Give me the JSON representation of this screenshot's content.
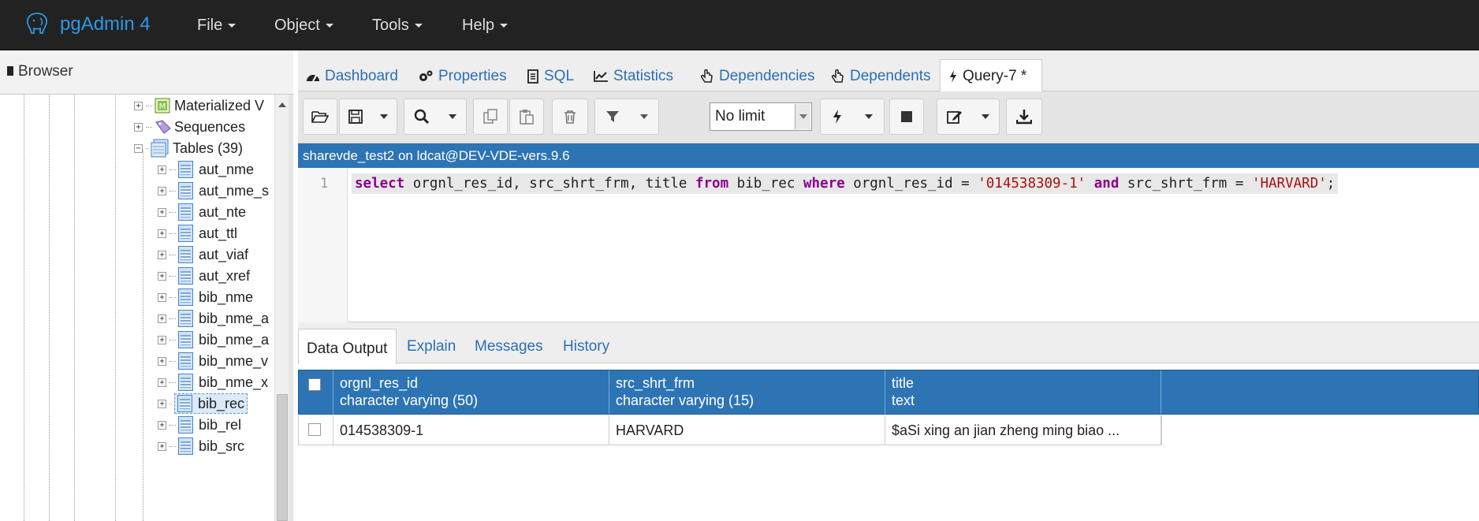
{
  "app": {
    "title": "pgAdmin 4",
    "brand_color": "#2d98e3"
  },
  "menu": [
    "File",
    "Object",
    "Tools",
    "Help"
  ],
  "browser": {
    "title": "Browser",
    "items": [
      {
        "label": "Materialized V",
        "icon": "materialized-view-icon",
        "expanded": false
      },
      {
        "label": "Sequences",
        "icon": "sequence-icon",
        "expanded": false
      },
      {
        "label": "Tables (39)",
        "icon": "tables-icon",
        "expanded": true
      },
      {
        "label": "aut_nme",
        "icon": "table-icon"
      },
      {
        "label": "aut_nme_s",
        "icon": "table-icon"
      },
      {
        "label": "aut_nte",
        "icon": "table-icon"
      },
      {
        "label": "aut_ttl",
        "icon": "table-icon"
      },
      {
        "label": "aut_viaf",
        "icon": "table-icon"
      },
      {
        "label": "aut_xref",
        "icon": "table-icon"
      },
      {
        "label": "bib_nme",
        "icon": "table-icon"
      },
      {
        "label": "bib_nme_a",
        "icon": "table-icon"
      },
      {
        "label": "bib_nme_a",
        "icon": "table-icon"
      },
      {
        "label": "bib_nme_v",
        "icon": "table-icon"
      },
      {
        "label": "bib_nme_x",
        "icon": "table-icon"
      },
      {
        "label": "bib_rec",
        "icon": "table-icon",
        "selected": true
      },
      {
        "label": "bib_rel",
        "icon": "table-icon"
      },
      {
        "label": "bib_src",
        "icon": "table-icon"
      }
    ]
  },
  "tabs": [
    {
      "label": "Dashboard",
      "icon": "dashboard-icon"
    },
    {
      "label": "Properties",
      "icon": "gears-icon"
    },
    {
      "label": "SQL",
      "icon": "file-text-icon"
    },
    {
      "label": "Statistics",
      "icon": "line-chart-icon"
    },
    {
      "label": "Dependencies",
      "icon": "hand-pointer-icon"
    },
    {
      "label": "Dependents",
      "icon": "hand-pointer-icon"
    },
    {
      "label": "Query-7 *",
      "icon": "bolt-icon",
      "active": true
    }
  ],
  "toolbar": {
    "limit_value": "No limit"
  },
  "connection": "sharevde_test2 on ldcat@DEV-VDE-vers.9.6",
  "editor": {
    "line_number": "1",
    "tokens": [
      {
        "t": "select",
        "k": "kw"
      },
      {
        "t": " orgnl_res_id, src_shrt_frm, title ",
        "k": ""
      },
      {
        "t": "from",
        "k": "kw"
      },
      {
        "t": " bib_rec ",
        "k": ""
      },
      {
        "t": "where",
        "k": "kw"
      },
      {
        "t": " orgnl_res_id = ",
        "k": ""
      },
      {
        "t": "'014538309-1'",
        "k": "str"
      },
      {
        "t": " ",
        "k": ""
      },
      {
        "t": "and",
        "k": "kw"
      },
      {
        "t": " src_shrt_frm = ",
        "k": ""
      },
      {
        "t": "'HARVARD'",
        "k": "str"
      },
      {
        "t": ";",
        "k": ""
      }
    ]
  },
  "results": {
    "tabs": [
      "Data Output",
      "Explain",
      "Messages",
      "History"
    ],
    "columns": [
      {
        "name": "orgnl_res_id",
        "type": "character varying (50)"
      },
      {
        "name": "src_shrt_frm",
        "type": "character varying (15)"
      },
      {
        "name": "title",
        "type": "text"
      }
    ],
    "rows": [
      [
        "014538309-1",
        "HARVARD",
        "$aSi xing an jian zheng ming biao ..."
      ]
    ]
  }
}
